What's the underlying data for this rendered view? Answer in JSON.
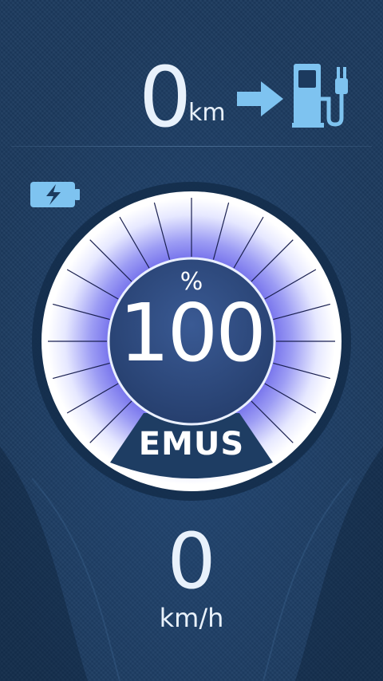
{
  "range": {
    "value": "0",
    "unit": "km"
  },
  "battery": {
    "percent_sign": "%",
    "level": "100",
    "level_fraction": 1.0
  },
  "brand": {
    "logo_text": "EMUS"
  },
  "speed": {
    "value": "0",
    "unit": "km/h"
  },
  "icons": {
    "range_arrow": "arrow-right-icon",
    "charging_station": "charging-station-icon",
    "battery": "battery-charging-icon"
  },
  "colors": {
    "background": "#1c3a5e",
    "icon_blue": "#7ec3f0",
    "gauge_glow": "#6a66e8",
    "gauge_center": "#2f4d82",
    "text": "#e8f1fb"
  }
}
